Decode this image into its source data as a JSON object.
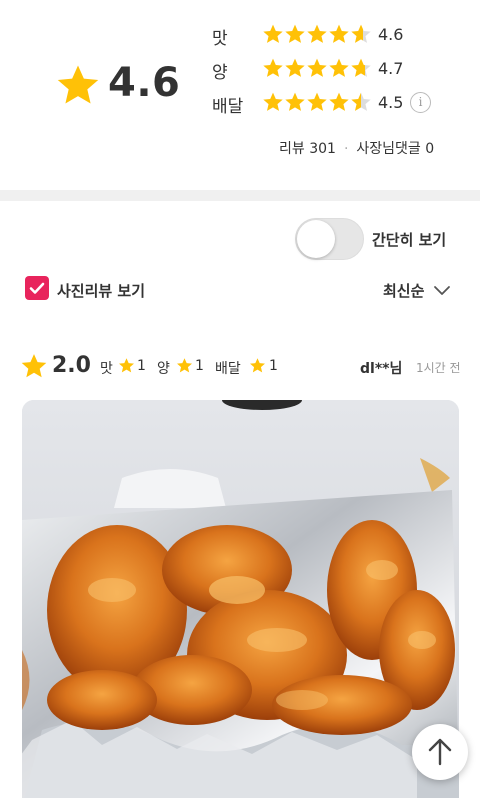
{
  "summary": {
    "overall_score": "4.6",
    "overall_rating": 4.6,
    "categories": [
      {
        "label": "맛",
        "score": "4.6",
        "rating": 4.6
      },
      {
        "label": "양",
        "score": "4.7",
        "rating": 4.7
      },
      {
        "label": "배달",
        "score": "4.5",
        "rating": 4.5
      }
    ],
    "info_icon": "info-icon",
    "review_count_label": "리뷰 301",
    "owner_reply_label": "사장님댓글 0",
    "star_color": "#ffc107"
  },
  "filters": {
    "simple_view_label": "간단히 보기",
    "simple_view_on": false,
    "photo_review_label": "사진리뷰 보기",
    "photo_review_checked": true,
    "checkbox_color": "#e8245c",
    "sort_label": "최신순"
  },
  "review": {
    "score": "2.0",
    "subscores": [
      {
        "label": "맛",
        "value": "1"
      },
      {
        "label": "양",
        "value": "1"
      },
      {
        "label": "배달",
        "value": "1"
      }
    ],
    "user": "dl**님",
    "time": "1시간 전",
    "photo_icon": "food-photo"
  },
  "scroll_top_icon": "arrow-up-icon"
}
